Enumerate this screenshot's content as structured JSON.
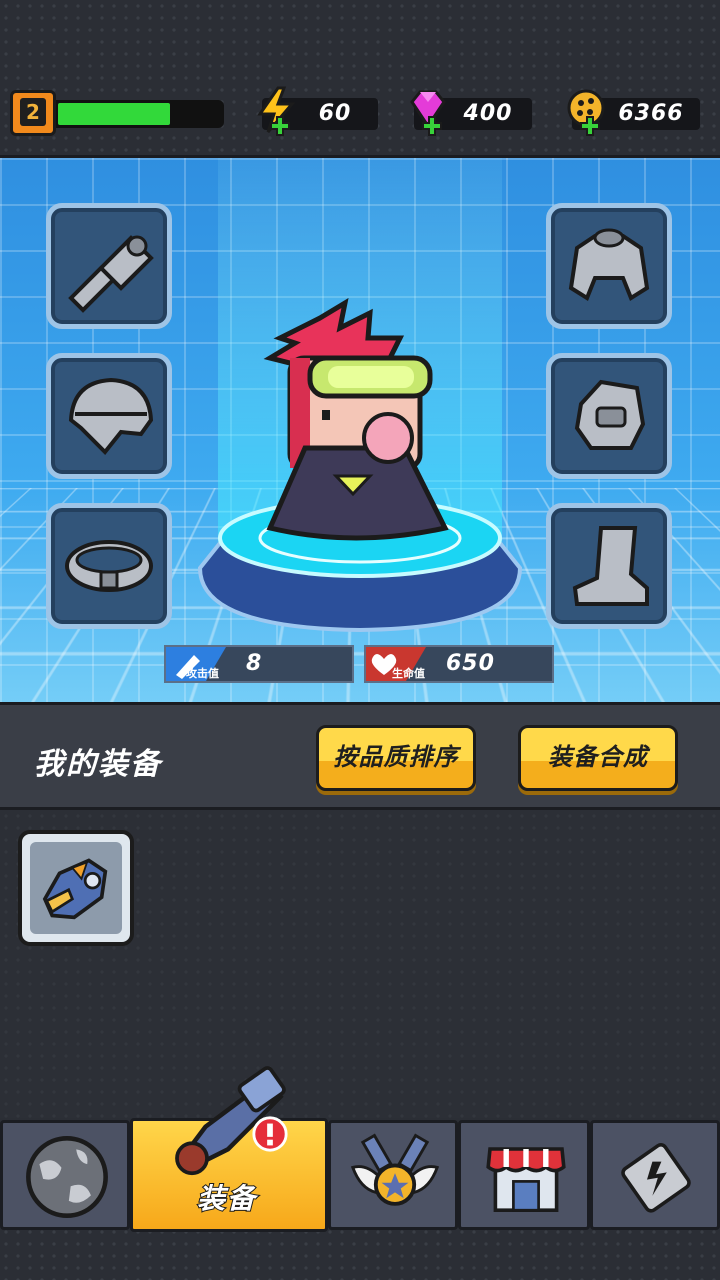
{
  "player": {
    "level": "2",
    "xp_progress": 0.68
  },
  "resources": {
    "energy": "60",
    "gems": "400",
    "coins": "6366"
  },
  "hero_stats": {
    "attack_label": "攻击值",
    "attack": "8",
    "health_label": "生命值",
    "health": "650"
  },
  "equipment": {
    "title": "我的装备",
    "sort_button": "按品质排序",
    "merge_button": "装备合成"
  },
  "slots_left": [
    "weapon-slot",
    "helmet-slot",
    "belt-slot"
  ],
  "slots_right": [
    "armor-slot",
    "gloves-slot",
    "boots-slot"
  ],
  "nav": {
    "tabs": [
      {
        "id": "world",
        "label": ""
      },
      {
        "id": "equip",
        "label": "装备",
        "badge": "!"
      },
      {
        "id": "rank",
        "label": ""
      },
      {
        "id": "shop",
        "label": ""
      },
      {
        "id": "battery",
        "label": ""
      }
    ]
  },
  "colors": {
    "accent_yellow": "#ffd94a",
    "stage_blue": "#3eaaf0",
    "xp_green": "#32d93a"
  }
}
